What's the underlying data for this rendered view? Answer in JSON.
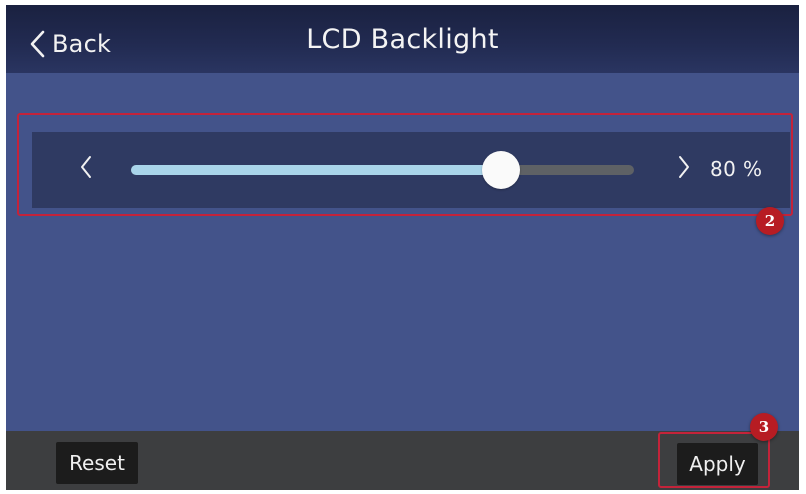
{
  "header": {
    "back_label": "Back",
    "back_icon": "chevron-left-icon",
    "title": "LCD Backlight"
  },
  "backlight": {
    "value": 80,
    "min": 0,
    "max": 100,
    "value_label": "80 %",
    "decrease_icon": "chevron-left-icon",
    "increase_icon": "chevron-right-icon"
  },
  "footer": {
    "reset_label": "Reset",
    "apply_label": "Apply"
  },
  "annotations": {
    "slider_badge": "2",
    "apply_badge": "3"
  },
  "colors": {
    "screen_bg": "#43538a",
    "titlebar_bg": "#1f2749",
    "panel_bg": "#2f3a62",
    "track_fill": "#a9d4ea",
    "track_empty": "#5e6165",
    "bottombar_bg": "#3d3e40",
    "button_bg": "#1c1c1c",
    "highlight": "#c4233a",
    "badge": "#b71c23"
  }
}
